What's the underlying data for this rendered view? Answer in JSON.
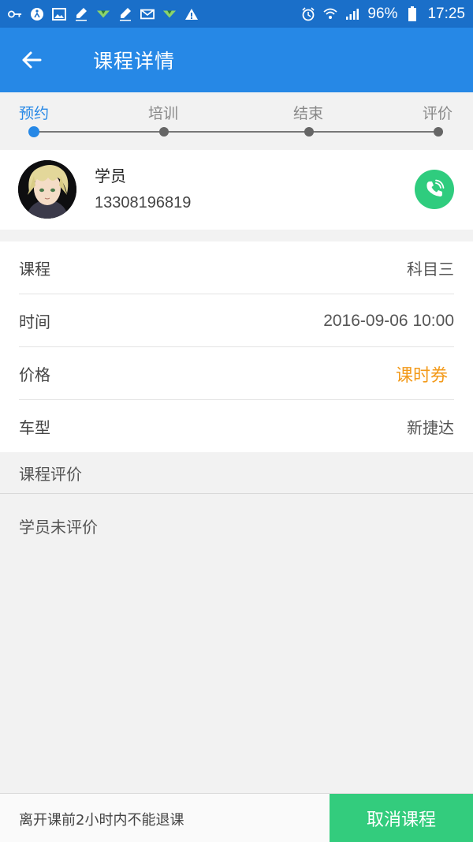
{
  "status_bar": {
    "left_icons": [
      "key-icon",
      "accessibility-icon",
      "image-icon",
      "pen-icon",
      "download-icon",
      "pen-icon",
      "mail-icon",
      "download-icon",
      "warning-icon"
    ],
    "right_icons": [
      "alarm-icon",
      "wifi-icon",
      "signal-icon",
      "battery-icon"
    ],
    "battery": "96%",
    "time": "17:25"
  },
  "appbar": {
    "title": "课程详情"
  },
  "steps": [
    {
      "label": "预约",
      "active": true
    },
    {
      "label": "培训",
      "active": false
    },
    {
      "label": "结束",
      "active": false
    },
    {
      "label": "评价",
      "active": false
    }
  ],
  "student": {
    "role": "学员",
    "phone": "13308196819"
  },
  "info": [
    {
      "label": "课程",
      "value": "科目三"
    },
    {
      "label": "时间",
      "value": "2016-09-06 10:00"
    },
    {
      "label": "价格",
      "value": "课时券"
    },
    {
      "label": "车型",
      "value": "新捷达"
    }
  ],
  "evaluation": {
    "title": "课程评价",
    "content": "学员未评价"
  },
  "bottom": {
    "note": "离开课前2小时内不能退课",
    "cancel_label": "取消课程"
  },
  "colors": {
    "status_bar": "#1a6fc9",
    "app_bar": "#2688e6",
    "accent": "#2688e6",
    "price": "#f39a1a",
    "call": "#2fcc7e",
    "cancel": "#33cc7d"
  }
}
